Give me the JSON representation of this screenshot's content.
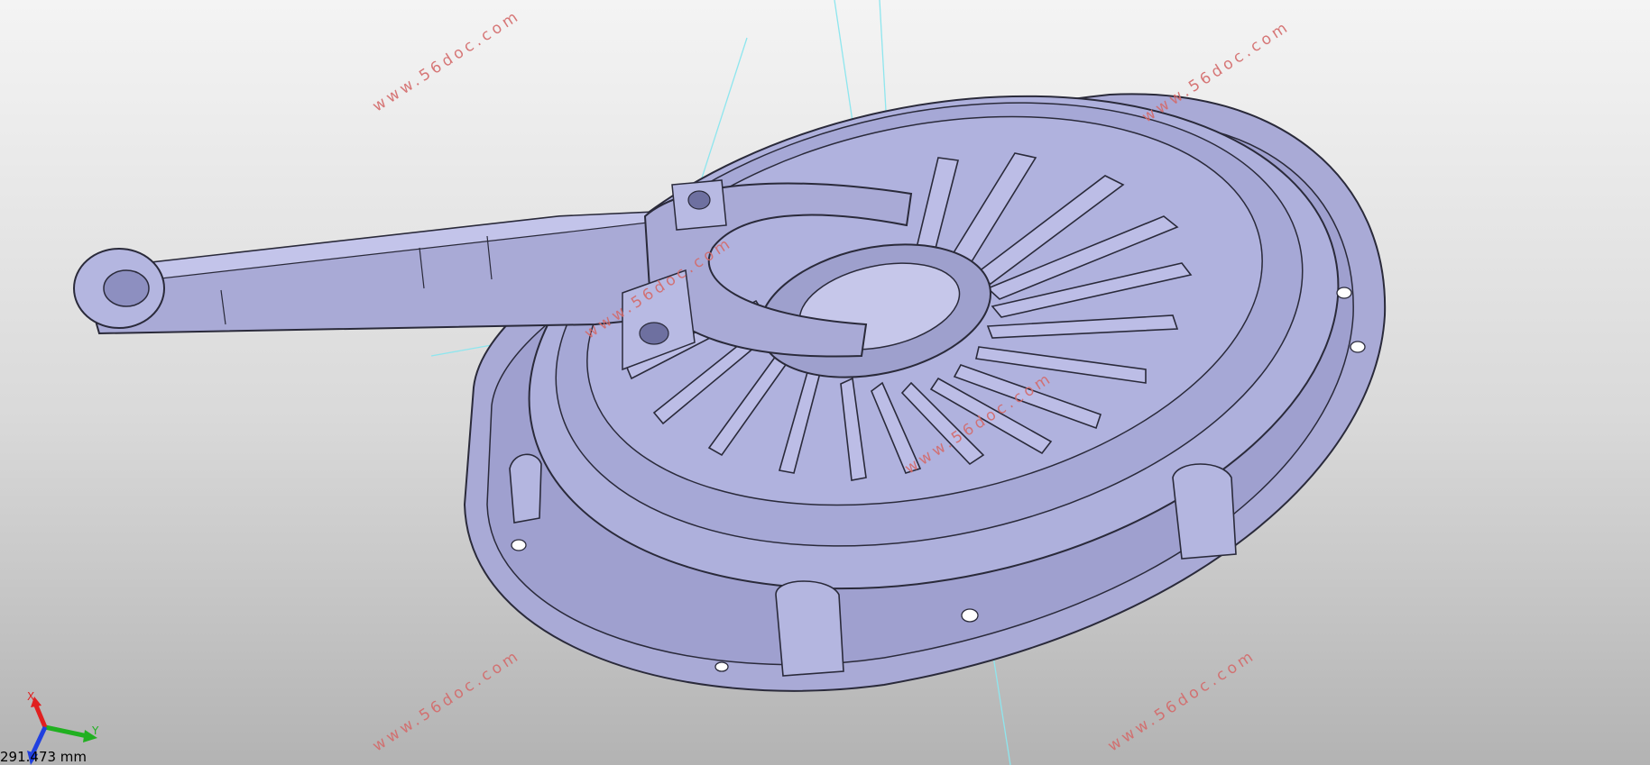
{
  "viewport": {
    "background_top": "#f4f4f4",
    "background_bottom": "#b3b3b3",
    "model_color": "#a9aad6",
    "model_edge": "#2a2a3a",
    "construction_line_color": "#8ee6ee"
  },
  "watermarks": [
    "www.56doc.com",
    "www.56doc.com",
    "www.56doc.com",
    "www.56doc.com",
    "www.56doc.com",
    "www.56doc.com"
  ],
  "triad": {
    "x_label": "X",
    "y_label": "Y",
    "x_color": "#e02020",
    "y_color": "#20b020",
    "z_color": "#2040e0"
  },
  "scale_readout": "291.473 mm"
}
